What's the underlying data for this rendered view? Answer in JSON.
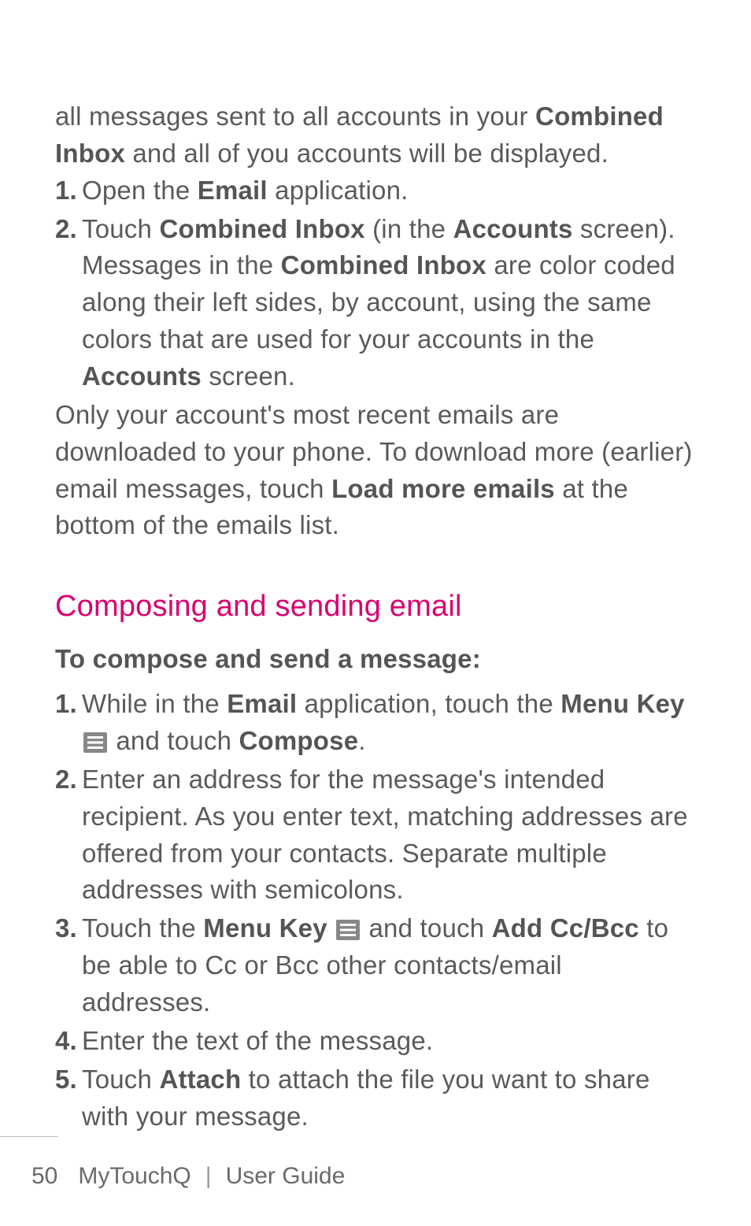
{
  "intro": {
    "pre": "all messages sent to all accounts in your ",
    "bold1": "Combined Inbox",
    "post": " and all of you accounts will be displayed."
  },
  "list1": [
    {
      "num": "1.",
      "parts": [
        {
          "t": " Open the "
        },
        {
          "t": "Email",
          "b": true
        },
        {
          "t": " application."
        }
      ]
    },
    {
      "num": "2.",
      "parts": [
        {
          "t": "Touch "
        },
        {
          "t": "Combined Inbox",
          "b": true
        },
        {
          "t": " (in the "
        },
        {
          "t": "Accounts",
          "b": true
        },
        {
          "t": " screen). Messages in the "
        },
        {
          "t": "Combined Inbox",
          "b": true
        },
        {
          "t": " are color coded along their left sides, by account, using the same colors that are used for your accounts in the "
        },
        {
          "t": "Accounts",
          "b": true
        },
        {
          "t": " screen."
        }
      ]
    }
  ],
  "after1": {
    "parts": [
      {
        "t": "Only your account's most recent emails are downloaded to your phone. To download more (earlier) email messages, touch "
      },
      {
        "t": "Load more emails",
        "b": true
      },
      {
        "t": " at the bottom of the emails list."
      }
    ]
  },
  "heading": "Composing and sending email",
  "subheading": "To compose and send a message:",
  "list2": [
    {
      "num": "1.",
      "parts": [
        {
          "t": " While in the "
        },
        {
          "t": "Email",
          "b": true
        },
        {
          "t": " application, touch the "
        },
        {
          "t": "Menu Key",
          "b": true
        },
        {
          "t": " "
        },
        {
          "icon": "menu"
        },
        {
          "t": " and touch "
        },
        {
          "t": "Compose",
          "b": true
        },
        {
          "t": "."
        }
      ]
    },
    {
      "num": "2.",
      "parts": [
        {
          "t": "Enter an address for the message's intended recipient. As you enter text, matching addresses are offered from your contacts. Separate multiple addresses with semicolons."
        }
      ]
    },
    {
      "num": "3.",
      "parts": [
        {
          "t": "Touch the "
        },
        {
          "t": "Menu Key",
          "b": true
        },
        {
          "t": " "
        },
        {
          "icon": "menu"
        },
        {
          "t": " and touch "
        },
        {
          "t": "Add Cc/Bcc",
          "b": true
        },
        {
          "t": " to be able to Cc or Bcc other contacts/email addresses."
        }
      ]
    },
    {
      "num": "4.",
      "parts": [
        {
          "t": "Enter the text of the message."
        }
      ]
    },
    {
      "num": "5.",
      "parts": [
        {
          "t": "Touch "
        },
        {
          "t": "Attach",
          "b": true
        },
        {
          "t": " to attach the file you want to share with your message."
        }
      ]
    }
  ],
  "footer": {
    "page_number": "50",
    "product": "MyTouchQ",
    "sep": "|",
    "doc": "User Guide"
  }
}
